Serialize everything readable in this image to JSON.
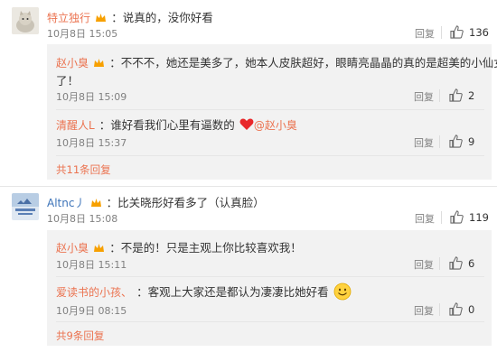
{
  "comments": [
    {
      "user": "特立独行",
      "text": "：说真的，没你好看",
      "time": "10月8日 15:05",
      "reply_label": "回复",
      "likes": "136",
      "replies": [
        {
          "user": "赵小臭",
          "text_line1": "：不不不，她还是美多了，她本人皮肤超好，眼睛亮晶晶的真的是超美的小仙女",
          "text_line2": "了！",
          "time": "10月8日 15:09",
          "reply_label": "回复",
          "likes": "2"
        },
        {
          "user": "清醒人L",
          "text": "：谁好看我们心里有逼数的",
          "mention": "@赵小臭",
          "time": "10月8日 15:37",
          "reply_label": "回复",
          "likes": "9"
        }
      ],
      "more_label": "共11条回复"
    },
    {
      "user": "Altnc丿",
      "text": "：比关晓彤好看多了（认真脸）",
      "time": "10月8日 15:08",
      "reply_label": "回复",
      "likes": "119",
      "replies": [
        {
          "user": "赵小臭",
          "text": "：不是的！只是主观上你比较喜欢我！",
          "time": "10月8日 15:11",
          "reply_label": "回复",
          "likes": "6"
        },
        {
          "user": "爱读书的小孩、",
          "text": "：客观上大家还是都认为凄凄比她好看",
          "time": "10月9日 08:15",
          "reply_label": "回复",
          "likes": "0"
        }
      ],
      "more_label": "共9条回复"
    }
  ],
  "colors": {
    "username": "#eb7350",
    "subbox": "#f2f2f2",
    "vip_badge": "#f7a000",
    "heart": "#e8272a"
  },
  "icons": [
    "thumbs-up-icon",
    "vip-badge-icon",
    "heart-icon",
    "smile-emoji-icon",
    "cat-avatar",
    "blue-avatar"
  ]
}
